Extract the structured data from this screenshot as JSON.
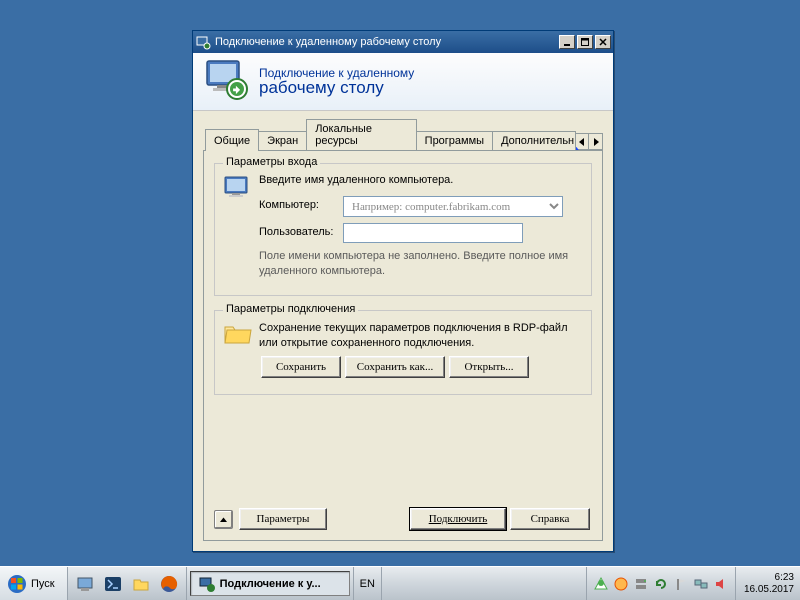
{
  "window": {
    "title": "Подключение к удаленному рабочему столу",
    "header_line1": "Подключение к удаленному",
    "header_line2": "рабочему столу"
  },
  "tabs": [
    "Общие",
    "Экран",
    "Локальные ресурсы",
    "Программы",
    "Дополнительн"
  ],
  "active_tab_index": 0,
  "login_group": {
    "title": "Параметры входа",
    "instruction": "Введите имя удаленного компьютера.",
    "computer_label": "Компьютер:",
    "computer_placeholder": "Например: computer.fabrikam.com",
    "computer_value": "",
    "user_label": "Пользователь:",
    "user_value": "",
    "warning": "Поле имени компьютера не заполнено. Введите полное имя удаленного компьютера."
  },
  "conn_group": {
    "title": "Параметры подключения",
    "instruction": "Сохранение текущих параметров подключения в RDP-файл или открытие сохраненного подключения.",
    "save": "Сохранить",
    "save_as": "Сохранить как...",
    "open": "Открыть..."
  },
  "buttons": {
    "options": "Параметры",
    "connect": "Подключить",
    "help": "Справка"
  },
  "taskbar": {
    "start": "Пуск",
    "active_task": "Подключение к у...",
    "lang": "EN",
    "time": "6:23",
    "date": "16.05.2017"
  }
}
